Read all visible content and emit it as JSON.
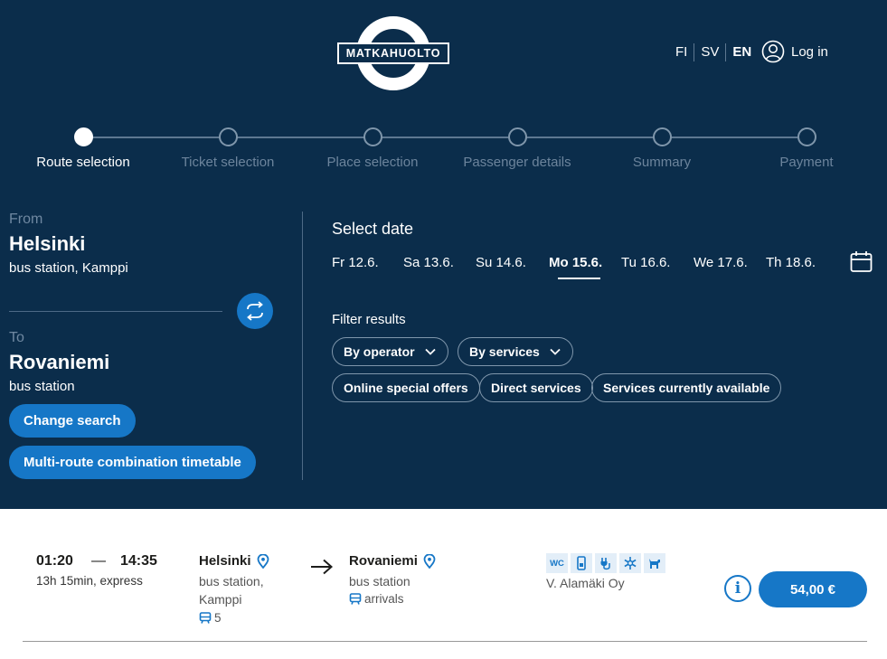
{
  "logo": {
    "text": "MATKAHUOLTO"
  },
  "header": {
    "languages": [
      {
        "code": "FI",
        "active": false
      },
      {
        "code": "SV",
        "active": false
      },
      {
        "code": "EN",
        "active": true
      }
    ],
    "login_label": "Log in",
    "login_icon": "user-circle-icon"
  },
  "stepper": {
    "steps": [
      {
        "label": "Route selection",
        "active": true
      },
      {
        "label": "Ticket selection",
        "active": false
      },
      {
        "label": "Place selection",
        "active": false
      },
      {
        "label": "Passenger details",
        "active": false
      },
      {
        "label": "Summary",
        "active": false
      },
      {
        "label": "Payment",
        "active": false
      }
    ]
  },
  "route": {
    "from_label": "From",
    "from_city": "Helsinki",
    "from_station": "bus station, Kamppi",
    "to_label": "To",
    "to_city": "Rovaniemi",
    "to_station": "bus station",
    "swap_icon": "swap-arrows-icon",
    "change_search_label": "Change search",
    "multi_route_label": "Multi-route combination timetable"
  },
  "date_select": {
    "title": "Select date",
    "dates": [
      {
        "label": "Fr 12.6.",
        "active": false
      },
      {
        "label": "Sa 13.6.",
        "active": false
      },
      {
        "label": "Su 14.6.",
        "active": false
      },
      {
        "label": "Mo 15.6.",
        "active": true
      },
      {
        "label": "Tu 16.6.",
        "active": false
      },
      {
        "label": "We 17.6.",
        "active": false
      },
      {
        "label": "Th 18.6.",
        "active": false
      }
    ],
    "calendar_icon": "calendar-icon"
  },
  "filters": {
    "title": "Filter results",
    "dropdowns": [
      "By operator",
      "By services"
    ],
    "chips": [
      "Online special offers",
      "Direct services",
      "Services currently available"
    ]
  },
  "result": {
    "departure_time": "01:20",
    "separator": "—",
    "arrival_time": "14:35",
    "duration": "13h 15min, express",
    "from_city": "Helsinki",
    "from_station_line1": "bus station,",
    "from_station_line2": "Kamppi",
    "platform": "5",
    "to_city": "Rovaniemi",
    "to_station": "bus station",
    "arrivals_label": "arrivals",
    "services": [
      {
        "icon": "wc-icon",
        "text": "WC"
      },
      {
        "icon": "phone-charger-icon",
        "text": ""
      },
      {
        "icon": "power-plug-icon",
        "text": ""
      },
      {
        "icon": "air-conditioning-icon",
        "text": ""
      },
      {
        "icon": "pet-icon",
        "text": ""
      }
    ],
    "operator": "V. Alamäki Oy",
    "info_label": "i",
    "price": "54,00 €"
  },
  "colors": {
    "hero_bg": "#0b2d4b",
    "accent": "#1677c7",
    "muted_text": "#6c849c"
  }
}
